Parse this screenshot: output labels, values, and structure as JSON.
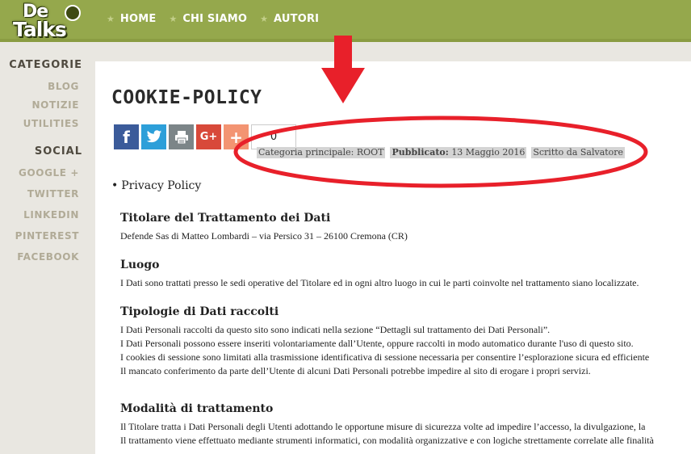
{
  "logo": {
    "top": "De",
    "bottom": "Talks"
  },
  "nav": {
    "items": [
      {
        "label": "HOME"
      },
      {
        "label": "CHI SIAMO"
      },
      {
        "label": "AUTORI"
      }
    ]
  },
  "sidebar": {
    "categories_heading": "CATEGORIE",
    "categories": [
      "BLOG",
      "NOTIZIE",
      "UTILITIES"
    ],
    "social_heading": "SOCIAL",
    "social": [
      "GOOGLE +",
      "TWITTER",
      "LINKEDIN",
      "PINTEREST",
      "FACEBOOK"
    ]
  },
  "article": {
    "title": "COOKIE-POLICY",
    "share_count": "0",
    "meta": {
      "category_label": "Categoria principale:",
      "category_value": "ROOT",
      "published_label": "Pubblicato:",
      "published_value": "13 Maggio 2016",
      "author": "Scritto da Salvatore"
    },
    "bullet": "Privacy Policy",
    "sections": [
      {
        "heading": "Titolare del Trattamento dei Dati",
        "lines": [
          "Defende Sas di Matteo Lombardi – via Persico 31 – 26100 Cremona (CR)"
        ]
      },
      {
        "heading": "Luogo",
        "lines": [
          "I Dati sono trattati presso le sedi operative del Titolare ed in ogni altro luogo in cui le parti coinvolte nel trattamento siano localizzate."
        ]
      },
      {
        "heading": "Tipologie di Dati raccolti",
        "lines": [
          "I Dati Personali raccolti da questo sito sono indicati nella sezione “Dettagli sul trattamento dei Dati Personali”.",
          "I Dati Personali possono essere inseriti volontariamente dall’Utente, oppure raccolti in modo automatico durante l'uso di questo sito.",
          "I cookies di sessione sono limitati alla trasmissione identificativa di sessione necessaria per consentire l’esplorazione sicura ed efficiente",
          "Il mancato conferimento da parte dell’Utente di alcuni Dati Personali potrebbe impedire al sito di erogare i propri servizi."
        ]
      },
      {
        "heading": "Modalità di trattamento",
        "lines": [
          "Il Titolare tratta i Dati Personali degli Utenti adottando le opportune misure di sicurezza volte ad impedire l’accesso, la divulgazione, la",
          "Il trattamento viene effettuato mediante strumenti informatici, con modalità organizzative e con logiche strettamente correlate alle finalità"
        ]
      }
    ]
  },
  "colors": {
    "nav_bg": "#95a84c",
    "annotation_red": "#e8202a",
    "facebook": "#3b5b9a",
    "twitter": "#2d9fd9",
    "print": "#7c8588",
    "google_plus": "#d8493a",
    "plus": "#f39472"
  },
  "icons": [
    "facebook-icon",
    "twitter-icon",
    "print-icon",
    "google-plus-icon",
    "plus-icon",
    "star-icon"
  ]
}
